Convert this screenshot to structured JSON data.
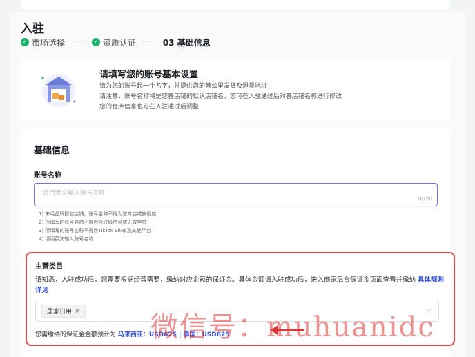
{
  "page": {
    "title": "入驻",
    "steps": [
      {
        "label": "市场选择",
        "done": true
      },
      {
        "label": "资质认证",
        "done": true
      },
      {
        "label": "03 基础信息",
        "done": false
      }
    ]
  },
  "intro": {
    "title": "请填写您的账号基本设置",
    "lines": [
      "请为您的账号起一个名字，并提供您的首公里发货及退货地址",
      "请注意，账号名称将是您各店铺的默认店铺名，您可在入驻通过后对各店铺名称进行修改",
      "您的仓库信息也可在入驻通过后调整"
    ]
  },
  "form": {
    "title": "基础信息",
    "account_label": "账号名称",
    "account_placeholder": "请用英文输入账号名称",
    "account_counter": "0/120",
    "rules": [
      "1) 未经品牌授权店铺，账号名称不得为官方店或旗舰店",
      "2) 所填写的账号名称不得包含垃圾信息或无效字符",
      "3) 所填写的账号名称不得涉TikTok Shop及其他平台",
      "4) 请用英文输入账号名称"
    ]
  },
  "category": {
    "title": "主营类目",
    "note": "请知悉，入驻成功后，您需要根据经营需要，缴纳对应金额的保证金。具体金额请入驻成功后，进入商家后台保证金页面查看并缴纳",
    "link": "具体规则详见",
    "selected_tag": "居家日用",
    "tag_close": "×",
    "deposit_prefix": "您需缴纳的保证金金额预计为",
    "deposit_value": "马来西亚：USD625 | 泰国：USD625"
  },
  "watermark": {
    "text": "微信号：muhuanidc"
  },
  "colors": {
    "accent": "#7b6cf0",
    "success": "#19b36b",
    "link": "#3451d6",
    "highlight_border": "#e34a4a"
  }
}
